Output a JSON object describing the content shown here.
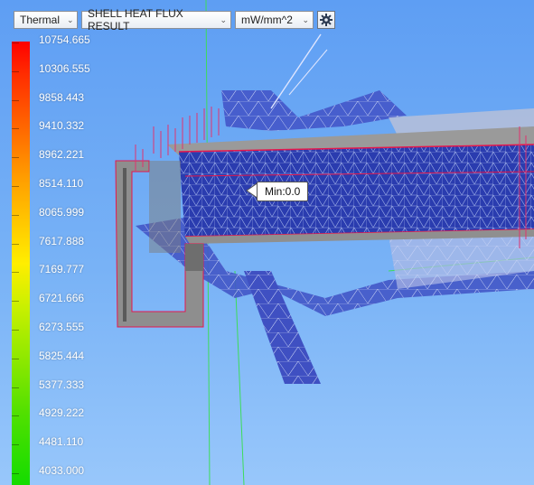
{
  "toolbar": {
    "analysis_type": "Thermal",
    "result_type": "SHELL HEAT FLUX RESULT",
    "unit": "mW/mm^2",
    "settings_icon": "gear-icon"
  },
  "legend": {
    "values": [
      "10754.665",
      "10306.555",
      "9858.443",
      "9410.332",
      "8962.221",
      "8514.110",
      "8065.999",
      "7617.888",
      "7169.777",
      "6721.666",
      "6273.555",
      "5825.444",
      "5377.333",
      "4929.222",
      "4481.110",
      "4033.000"
    ]
  },
  "probe": {
    "label": "Min:0.0"
  },
  "colors": {
    "background_top": "#5e9ef3",
    "background_bottom": "#98c7fb",
    "mesh": "#2b3fb0",
    "wall": "#8a8a8a"
  }
}
